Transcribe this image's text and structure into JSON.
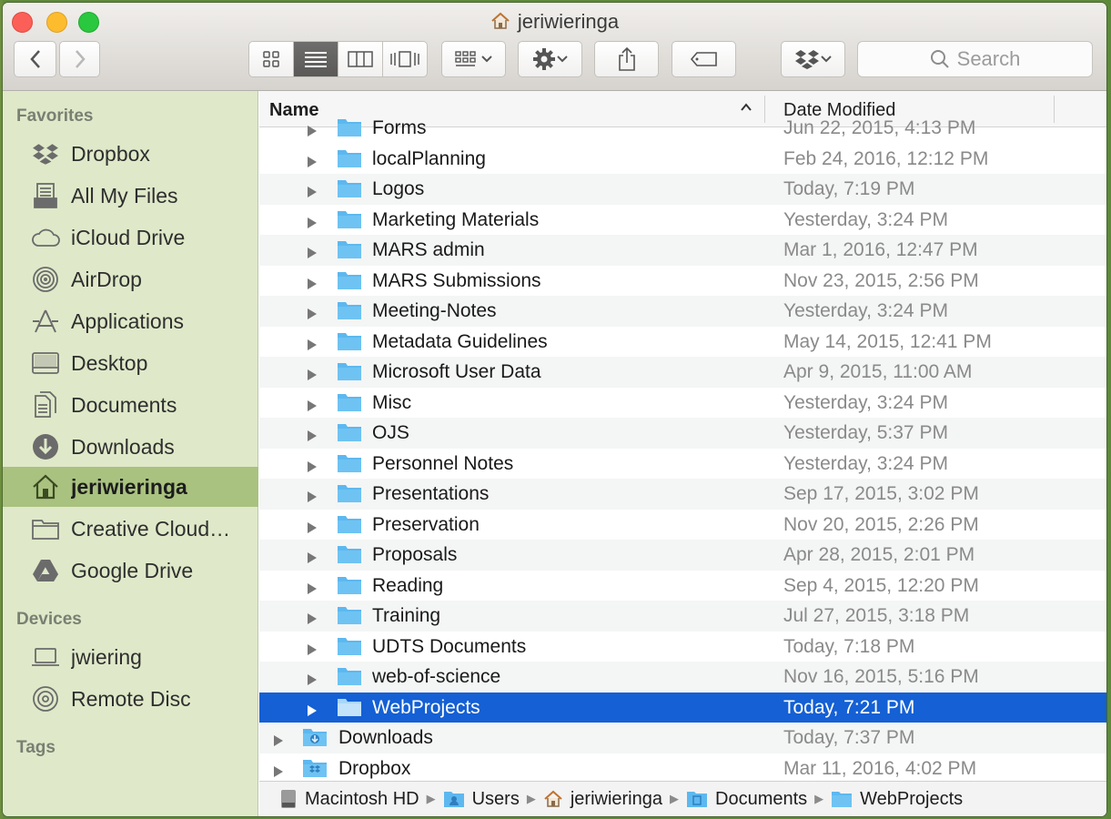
{
  "window": {
    "title": "jeriwieringa"
  },
  "toolbar": {
    "search_placeholder": "Search"
  },
  "sidebar": {
    "favorites_heading": "Favorites",
    "favorites": [
      {
        "label": "Dropbox",
        "icon": "dropbox-icon"
      },
      {
        "label": "All My Files",
        "icon": "all-files-icon"
      },
      {
        "label": "iCloud Drive",
        "icon": "cloud-icon"
      },
      {
        "label": "AirDrop",
        "icon": "airdrop-icon"
      },
      {
        "label": "Applications",
        "icon": "applications-icon"
      },
      {
        "label": "Desktop",
        "icon": "desktop-icon"
      },
      {
        "label": "Documents",
        "icon": "documents-icon"
      },
      {
        "label": "Downloads",
        "icon": "downloads-icon"
      },
      {
        "label": "jeriwieringa",
        "icon": "home-icon",
        "selected": true
      },
      {
        "label": "Creative Cloud…",
        "icon": "folder-icon"
      },
      {
        "label": "Google Drive",
        "icon": "google-drive-icon"
      }
    ],
    "devices_heading": "Devices",
    "devices": [
      {
        "label": "jwiering",
        "icon": "laptop-icon"
      },
      {
        "label": "Remote Disc",
        "icon": "disc-icon"
      }
    ],
    "tags_heading": "Tags"
  },
  "list": {
    "columns": {
      "name": "Name",
      "date": "Date Modified"
    },
    "partial_row": {
      "name": "Forms",
      "date": "Jun 22, 2015, 4:13 PM"
    },
    "rows": [
      {
        "name": "localPlanning",
        "date": "Feb 24, 2016, 12:12 PM"
      },
      {
        "name": "Logos",
        "date": "Today, 7:19 PM"
      },
      {
        "name": "Marketing Materials",
        "date": "Yesterday, 3:24 PM"
      },
      {
        "name": "MARS admin",
        "date": "Mar 1, 2016, 12:47 PM"
      },
      {
        "name": "MARS Submissions",
        "date": "Nov 23, 2015, 2:56 PM"
      },
      {
        "name": "Meeting-Notes",
        "date": "Yesterday, 3:24 PM"
      },
      {
        "name": "Metadata Guidelines",
        "date": "May 14, 2015, 12:41 PM"
      },
      {
        "name": "Microsoft User Data",
        "date": "Apr 9, 2015, 11:00 AM"
      },
      {
        "name": "Misc",
        "date": "Yesterday, 3:24 PM"
      },
      {
        "name": "OJS",
        "date": "Yesterday, 5:37 PM"
      },
      {
        "name": "Personnel Notes",
        "date": "Yesterday, 3:24 PM"
      },
      {
        "name": "Presentations",
        "date": "Sep 17, 2015, 3:02 PM"
      },
      {
        "name": "Preservation",
        "date": "Nov 20, 2015, 2:26 PM"
      },
      {
        "name": "Proposals",
        "date": "Apr 28, 2015, 2:01 PM"
      },
      {
        "name": "Reading",
        "date": "Sep 4, 2015, 12:20 PM"
      },
      {
        "name": "Training",
        "date": "Jul 27, 2015, 3:18 PM"
      },
      {
        "name": "UDTS Documents",
        "date": "Today, 7:18 PM"
      },
      {
        "name": "web-of-science",
        "date": "Nov 16, 2015, 5:16 PM"
      },
      {
        "name": "WebProjects",
        "date": "Today, 7:21 PM",
        "selected": true
      },
      {
        "name": "Downloads",
        "date": "Today, 7:37 PM",
        "level": 0,
        "icon": "downloads-folder-icon"
      },
      {
        "name": "Dropbox",
        "date": "Mar 11, 2016, 4:02 PM",
        "level": 0,
        "icon": "dropbox-folder-icon"
      }
    ]
  },
  "pathbar": {
    "crumbs": [
      {
        "label": "Macintosh HD",
        "icon": "hard-drive-icon"
      },
      {
        "label": "Users",
        "icon": "users-folder-icon"
      },
      {
        "label": "jeriwieringa",
        "icon": "home-icon"
      },
      {
        "label": "Documents",
        "icon": "documents-folder-icon"
      },
      {
        "label": "WebProjects",
        "icon": "folder-icon"
      }
    ]
  },
  "colors": {
    "selection": "#1460d4",
    "sidebar_bg": "#dfe9c9",
    "sidebar_selected": "#a9c27f",
    "folder_blue": "#5db8ef"
  }
}
